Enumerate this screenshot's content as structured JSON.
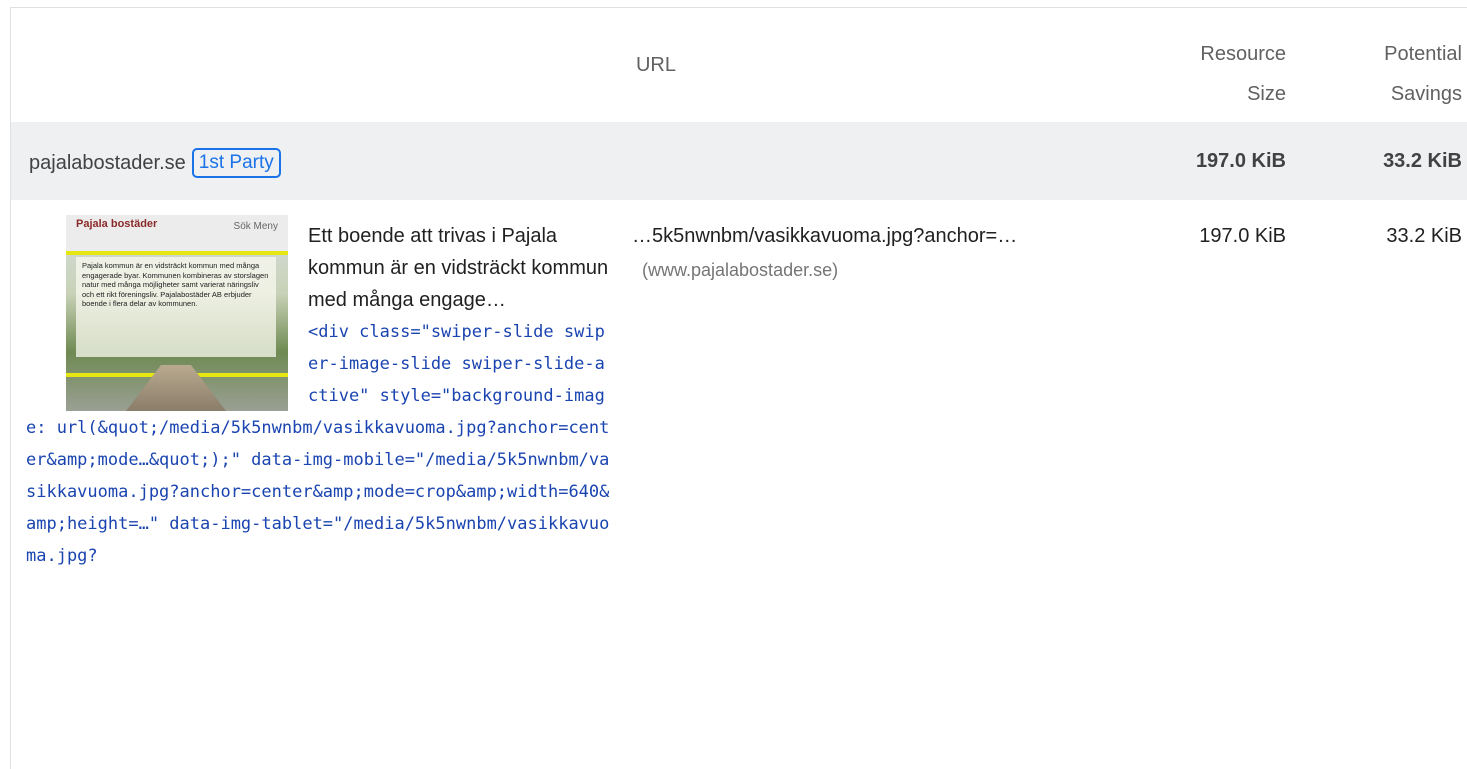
{
  "header": {
    "url_label": "URL",
    "size_label_1": "Resource",
    "size_label_2": "Size",
    "savings_label_1": "Potential",
    "savings_label_2": "Savings"
  },
  "group": {
    "name": "pajalabostader.se",
    "badge": "1st Party",
    "size": "197.0 KiB",
    "savings": "33.2 KiB"
  },
  "item": {
    "thumbnail": {
      "logo": "Pajala bostäder",
      "menu": "Sök  Meny",
      "text": "Pajala kommun är en vidsträckt kommun med många engagerade byar. Kommunen kombineras av storslagen natur med många möjligheter samt varierat näringsliv och ett rikt föreningsliv. Pajalabostäder AB erbjuder boende i flera delar av kommunen."
    },
    "snippet": "Ett boende att trivas i Pajala kommun är en vidsträckt kommun med många engage…",
    "code": "<div class=\"swiper-slide swiper-image-slide swiper-slide-active\" style=\"background-image: url(&quot;/media/5k5nwnbm/vasikkavuoma.jpg?anchor=center&amp;mode…&quot;);\" data-img-mobile=\"/media/5k5nwnbm/vasikkavuoma.jpg?anchor=center&amp;mode=crop&amp;width=640&amp;height=…\" data-img-tablet=\"/media/5k5nwnbm/vasikkavuoma.jpg?",
    "url": "…5k5nwnbm/vasikkavuoma.jpg?anchor=…",
    "host": "(www.pajalabostader.se)",
    "size": "197.0 KiB",
    "savings": "33.2 KiB"
  }
}
